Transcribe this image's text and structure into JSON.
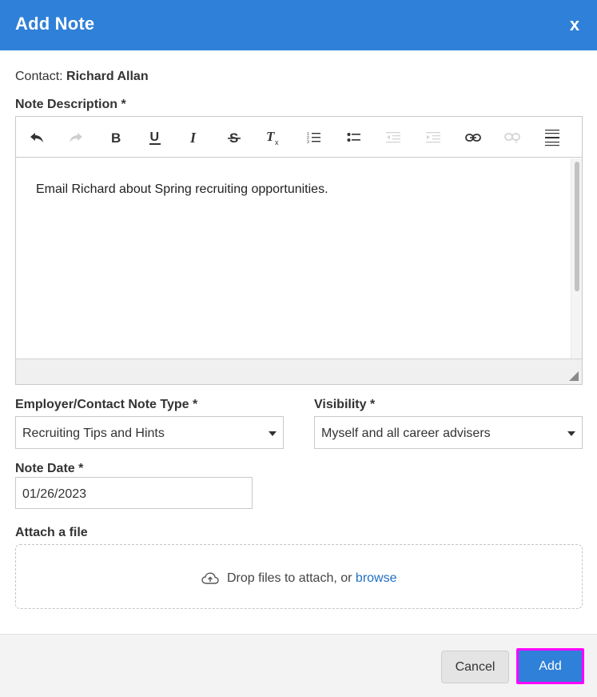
{
  "modal": {
    "title": "Add Note",
    "close_label": "x"
  },
  "contact": {
    "label": "Contact:",
    "name": "Richard Allan"
  },
  "note_description": {
    "label": "Note Description *",
    "content": "Email Richard about Spring recruiting opportunities.",
    "toolbar": [
      "undo-icon",
      "redo-icon",
      "bold-icon",
      "underline-icon",
      "italic-icon",
      "strikethrough-icon",
      "remove-format-icon",
      "numbered-list-icon",
      "bulleted-list-icon",
      "decrease-indent-icon",
      "increase-indent-icon",
      "link-icon",
      "unlink-icon",
      "horizontal-rule-icon"
    ]
  },
  "note_type": {
    "label": "Employer/Contact Note Type *",
    "value": "Recruiting Tips and Hints"
  },
  "visibility": {
    "label": "Visibility *",
    "value": "Myself and all career advisers"
  },
  "note_date": {
    "label": "Note Date *",
    "value": "01/26/2023"
  },
  "attachment": {
    "label": "Attach a file",
    "prompt": "Drop files to attach, or",
    "browse_label": "browse"
  },
  "footer": {
    "cancel_label": "Cancel",
    "add_label": "Add"
  },
  "colors": {
    "header": "#2f80d8",
    "primary_button": "#2f80d8",
    "focus_outline": "#ff00ff",
    "link": "#1f6fc2"
  }
}
